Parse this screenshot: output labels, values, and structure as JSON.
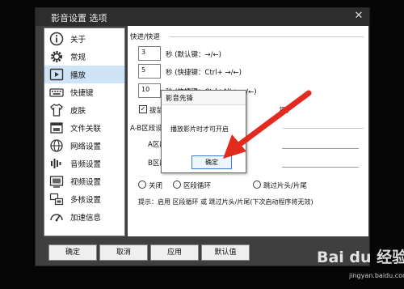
{
  "window": {
    "title": "影音设置 选项",
    "close_glyph": "✕"
  },
  "sidebar": {
    "items": [
      {
        "label": "关于",
        "icon": "info-icon"
      },
      {
        "label": "常规",
        "icon": "gear-icon"
      },
      {
        "label": "播放",
        "icon": "play-icon"
      },
      {
        "label": "快捷键",
        "icon": "keyboard-icon"
      },
      {
        "label": "皮肤",
        "icon": "shirt-icon"
      },
      {
        "label": "文件关联",
        "icon": "file-association-icon"
      },
      {
        "label": "网络设置",
        "icon": "network-icon"
      },
      {
        "label": "音频设置",
        "icon": "audio-icon"
      },
      {
        "label": "视频设置",
        "icon": "video-icon"
      },
      {
        "label": "多核设置",
        "icon": "multicore-icon"
      },
      {
        "label": "加速信息",
        "icon": "speed-icon"
      }
    ],
    "selected_index": 2
  },
  "panel": {
    "section_fast": "快进/快退",
    "rows": [
      {
        "value": "3",
        "text": "秒 (默认键：→/←)"
      },
      {
        "value": "5",
        "text": "秒 (快捷键：Ctrl+ →/←)"
      },
      {
        "value": "10",
        "text": "秒 (快捷键：Ctrl+Alt+ →/←)"
      }
    ],
    "checkbox_label_visible": "拔鼠",
    "checkbox_label_suffix": "键)",
    "section_ab": "A-B区段设",
    "a_label": "A区段(片",
    "b_label": "B区段(片",
    "radio_close": "关闭",
    "radio_loop": "区段循环",
    "radio_skip": "跳过片头/片尾",
    "hint": "提示：启用 区段循环 或 跳过片头/片尾(下次启动程序将无效)"
  },
  "buttons": {
    "ok": "确定",
    "cancel": "取消",
    "apply": "应用",
    "default": "默认值"
  },
  "dialog": {
    "title": "影音先锋",
    "message": "播放影片时才可开启",
    "ok": "确定"
  },
  "watermark": {
    "logo": "Bai du 经验",
    "sub": "jingyan.baidu.com"
  },
  "colors": {
    "arrow": "#e32a1f",
    "selection": "#cfe3f7",
    "focus": "#3c7fd6"
  }
}
